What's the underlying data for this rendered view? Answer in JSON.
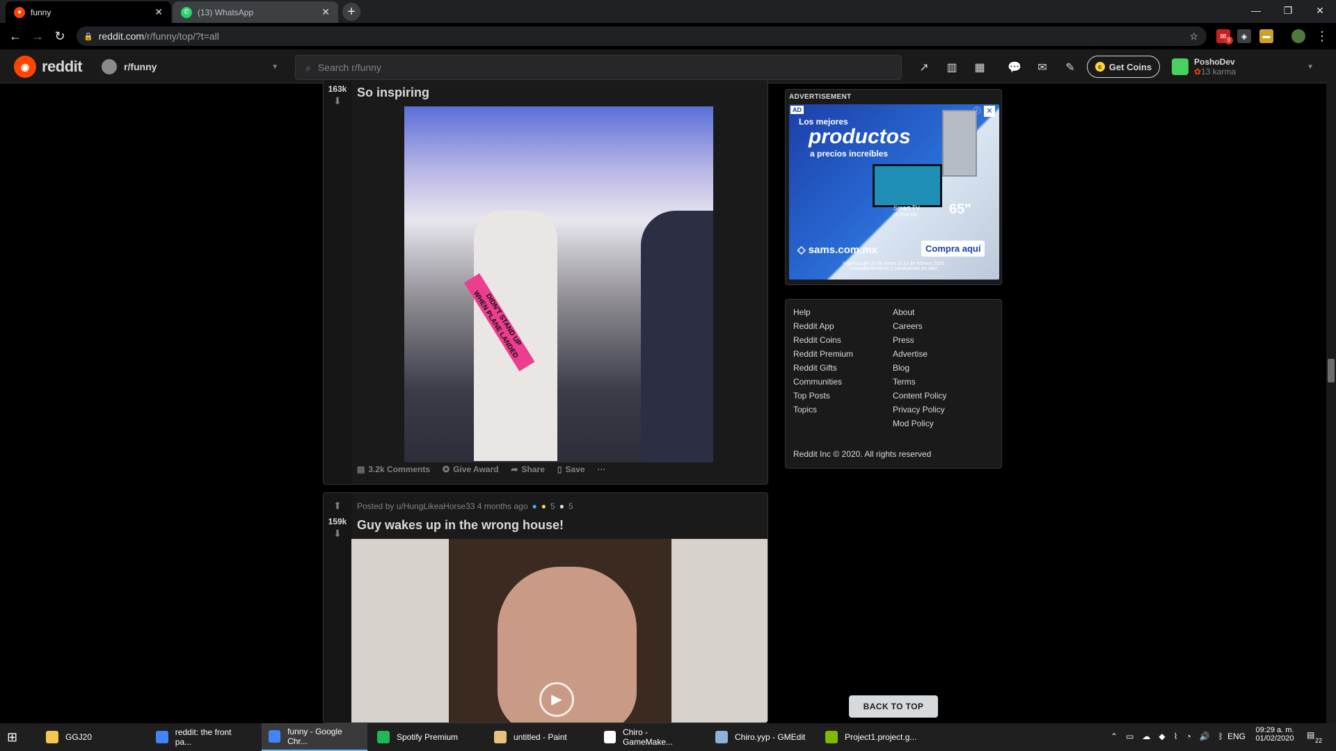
{
  "browser": {
    "tabs": [
      {
        "title": "funny",
        "active": true
      },
      {
        "title": "(13) WhatsApp",
        "active": false
      }
    ],
    "url_host": "reddit.com",
    "url_path": "/r/funny/top/?t=all"
  },
  "reddit": {
    "logo_text": "reddit",
    "subreddit": "r/funny",
    "search_placeholder": "Search r/funny",
    "get_coins": "Get Coins",
    "username": "PoshoDev",
    "karma": "13 karma"
  },
  "posts": [
    {
      "score": "163k",
      "title": "So inspiring",
      "image_text": [
        "DIDN'T STAND UP",
        "WHEN PLANE LANDED"
      ],
      "actions": {
        "comments": "3.2k Comments",
        "award": "Give Award",
        "share": "Share",
        "save": "Save",
        "more": "···"
      }
    },
    {
      "score": "159k",
      "posted_by": "Posted by u/HungLikeaHorse33 4 months ago",
      "award_count_1": "5",
      "award_count_2": "5",
      "title": "Guy wakes up in the wrong house!"
    }
  ],
  "sidebar": {
    "ad_label": "ADVERTISEMENT",
    "ad": {
      "badge": "AD",
      "line1": "Los mejores",
      "line2": "productos",
      "line3": "a precios increíbles",
      "tv_label": "Smart TV",
      "tv_sub": "ULTRA HD",
      "tv_size": "65\"",
      "brand": "sams.com.mx",
      "cta": "Compra aquí",
      "fine_print_1": "Vigencia del 22 de enero al 13 de febrero 2020.",
      "fine_print_2": "Consulta términos y condiciones en sitio."
    },
    "links_left": [
      "Help",
      "Reddit App",
      "Reddit Coins",
      "Reddit Premium",
      "Reddit Gifts",
      "Communities",
      "Top Posts",
      "Topics"
    ],
    "links_right": [
      "About",
      "Careers",
      "Press",
      "Advertise",
      "Blog",
      "Terms",
      "Content Policy",
      "Privacy Policy",
      "Mod Policy"
    ],
    "copyright": "Reddit Inc © 2020. All rights reserved",
    "back_to_top": "BACK TO TOP"
  },
  "taskbar": {
    "items": [
      {
        "label": "GGJ20",
        "color": "#f2c94c"
      },
      {
        "label": "reddit: the front pa...",
        "color": "#4285f4"
      },
      {
        "label": "funny - Google Chr...",
        "color": "#4285f4"
      },
      {
        "label": "Spotify Premium",
        "color": "#1db954"
      },
      {
        "label": "untitled - Paint",
        "color": "#e6c27a"
      },
      {
        "label": "Chiro - GameMake...",
        "color": "#ffffff"
      },
      {
        "label": "Chiro.yyp - GMEdit",
        "color": "#8fb0d8"
      },
      {
        "label": "Project1.project.g...",
        "color": "#7fba00"
      }
    ],
    "lang": "ENG",
    "time": "09:29 a. m.",
    "date": "01/02/2020",
    "notifications": "22"
  },
  "extensions": {
    "gmail_badge": "9"
  }
}
